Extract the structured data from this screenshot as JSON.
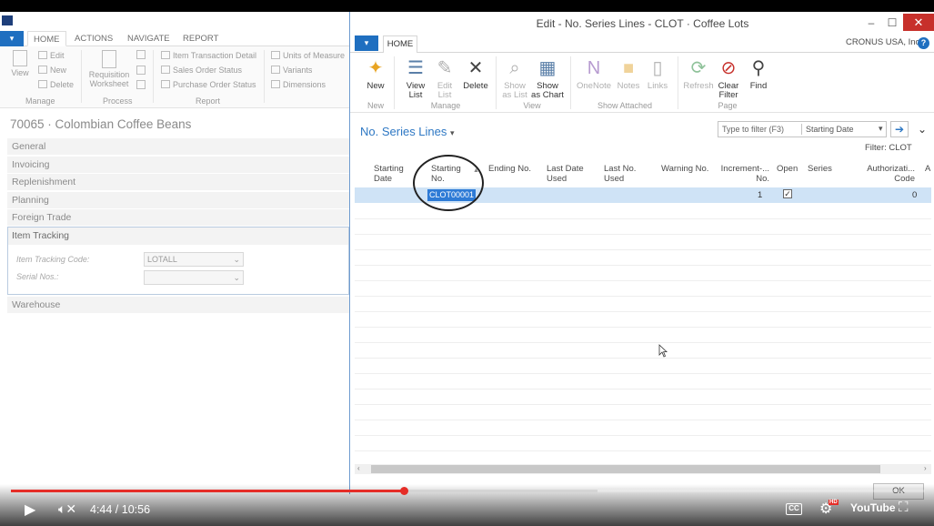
{
  "back_window": {
    "tabs": [
      "HOME",
      "ACTIONS",
      "NAVIGATE",
      "REPORT"
    ],
    "ribbon": {
      "manage": {
        "items": [
          "View",
          "Edit",
          "New",
          "Delete"
        ],
        "group": "Manage"
      },
      "process": {
        "items": [
          "Requisition Worksheet"
        ],
        "group": "Process"
      },
      "report": {
        "items": [
          "Item Transaction Detail",
          "Sales Order Status",
          "Purchase Order Status"
        ],
        "group": "Report"
      },
      "extra": [
        "Units of Measure",
        "Variants",
        "Dimensions"
      ]
    },
    "item_title": "70065 · Colombian Coffee Beans",
    "fasttabs": [
      "General",
      "Invoicing",
      "Replenishment",
      "Planning",
      "Foreign Trade",
      "Item Tracking",
      "Warehouse"
    ],
    "item_tracking": {
      "code_label": "Item Tracking Code:",
      "code_value": "LOTALL",
      "serial_label": "Serial Nos.:",
      "serial_value": ""
    }
  },
  "front_window": {
    "title": "Edit - No. Series Lines - CLOT · Coffee Lots",
    "tab": "HOME",
    "company": "CRONUS USA, Inc.",
    "ribbon": {
      "buttons": [
        "New",
        "View List",
        "Edit List",
        "Delete",
        "Show as List",
        "Show as Chart",
        "OneNote",
        "Notes",
        "Links",
        "Refresh",
        "Clear Filter",
        "Find"
      ],
      "groups": [
        "New",
        "Manage",
        "View",
        "Show Attached",
        "Page"
      ]
    },
    "page_title": "No. Series Lines",
    "filter_placeholder": "Type to filter (F3)",
    "filter_field": "Starting Date",
    "filter_label": "Filter: CLOT",
    "columns": [
      "Starting Date",
      "Starting No.",
      "Ending No.",
      "Last Date Used",
      "Last No. Used",
      "Warning No.",
      "Increment-... No.",
      "Open",
      "Series",
      "Authorizati... Code",
      "A"
    ],
    "row": {
      "starting_no": "CLOT00001",
      "increment": "1",
      "open": true,
      "authorization_code": "0"
    },
    "ok_label": "OK"
  },
  "player": {
    "time": "4:44 / 10:56",
    "progress": 0.43,
    "buffered": 0.64,
    "youtube_label": "YouTube",
    "hd_label": "HD",
    "cc_label": "CC"
  }
}
